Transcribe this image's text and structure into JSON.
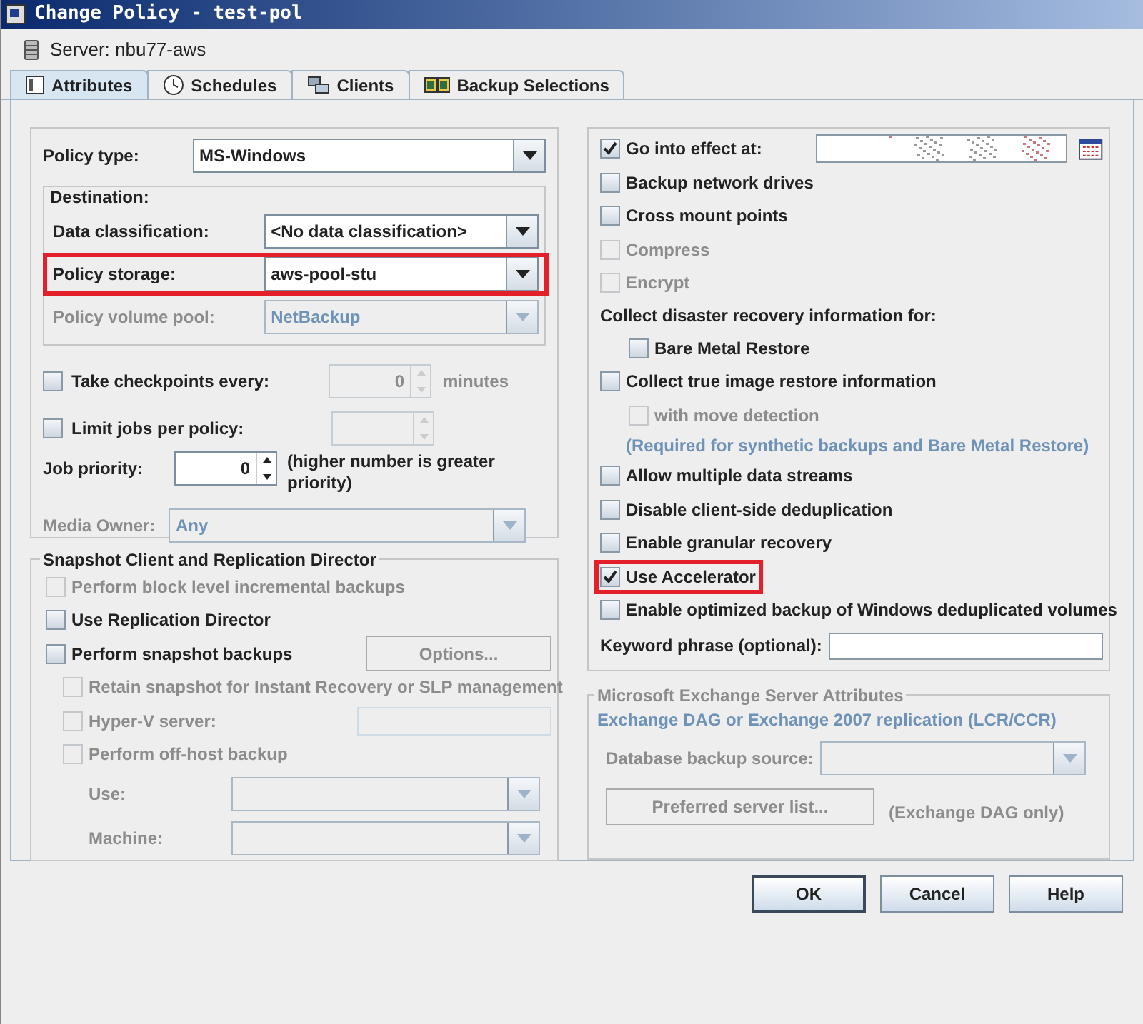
{
  "window": {
    "title": "Change Policy - test-pol"
  },
  "server": "Server: nbu77-aws",
  "tabs": [
    {
      "label": "Attributes",
      "selected": true
    },
    {
      "label": "Schedules",
      "selected": false
    },
    {
      "label": "Clients",
      "selected": false
    },
    {
      "label": "Backup Selections",
      "selected": false
    }
  ],
  "policy_type": {
    "label": "Policy type:",
    "value": "MS-Windows"
  },
  "destination": {
    "title": "Destination:",
    "fields": [
      {
        "label": "Data classification:",
        "value": "<No data classification>",
        "disabled": false,
        "highlighted": false
      },
      {
        "label": "Policy storage:",
        "value": "aws-pool-stu",
        "disabled": false,
        "highlighted": true
      },
      {
        "label": "Policy volume pool:",
        "value": "NetBackup",
        "disabled": true,
        "highlighted": false
      }
    ]
  },
  "checkpoints": {
    "label": "Take checkpoints every:",
    "checked": false,
    "value": "0",
    "unit": "minutes"
  },
  "limit_jobs": {
    "label": "Limit jobs per policy:",
    "checked": false
  },
  "job_priority": {
    "label": "Job priority:",
    "value": "0",
    "note": "(higher number is greater priority)"
  },
  "media_owner": {
    "label": "Media Owner:",
    "value": "Any",
    "disabled": true
  },
  "snapshot": {
    "title": "Snapshot Client and Replication Director",
    "items": [
      {
        "kind": "checkbox",
        "label": "Perform block level incremental backups",
        "checked": false,
        "disabled": true
      },
      {
        "kind": "checkbox",
        "label": "Use Replication Director",
        "checked": false,
        "disabled": false
      },
      {
        "kind": "checkbox",
        "label": "Perform snapshot backups",
        "checked": false,
        "disabled": false,
        "button": {
          "label": "Options...",
          "disabled": true
        },
        "children": [
          {
            "kind": "checkbox",
            "label": "Retain snapshot for Instant Recovery or SLP management",
            "checked": false,
            "disabled": true
          },
          {
            "kind": "checkbox_field",
            "label": "Hyper-V server:",
            "checked": false,
            "disabled": true
          },
          {
            "kind": "checkbox",
            "label": "Perform off-host backup",
            "checked": false,
            "disabled": true,
            "children": [
              {
                "kind": "dropdown",
                "label": "Use:",
                "disabled": true
              },
              {
                "kind": "dropdown",
                "label": "Machine:",
                "disabled": true
              }
            ]
          }
        ]
      }
    ]
  },
  "schedule": {
    "label": "Go into effect at:",
    "checked": true
  },
  "options": [
    {
      "kind": "checkbox",
      "label": "Backup network drives",
      "checked": false,
      "disabled": false,
      "highlighted": false
    },
    {
      "kind": "checkbox",
      "label": "Cross mount points",
      "checked": false,
      "disabled": false,
      "highlighted": false
    },
    {
      "kind": "checkbox",
      "label": "Compress",
      "checked": false,
      "disabled": true,
      "highlighted": false
    },
    {
      "kind": "checkbox",
      "label": "Encrypt",
      "checked": false,
      "disabled": true,
      "highlighted": false
    },
    {
      "kind": "heading",
      "label": "Collect disaster recovery information for:",
      "children": [
        {
          "kind": "checkbox",
          "label": "Bare Metal Restore",
          "checked": false,
          "disabled": false,
          "highlighted": false
        }
      ]
    },
    {
      "kind": "checkbox",
      "label": "Collect true image restore information",
      "checked": false,
      "disabled": false,
      "highlighted": false,
      "children": [
        {
          "kind": "checkbox",
          "label": "with move detection",
          "checked": false,
          "disabled": true,
          "highlighted": false
        },
        {
          "kind": "note",
          "label": "(Required for synthetic backups and Bare Metal Restore)"
        }
      ]
    },
    {
      "kind": "checkbox",
      "label": "Allow multiple data streams",
      "checked": false,
      "disabled": false,
      "highlighted": false
    },
    {
      "kind": "checkbox",
      "label": "Disable client-side deduplication",
      "checked": false,
      "disabled": false,
      "highlighted": false
    },
    {
      "kind": "checkbox",
      "label": "Enable granular recovery",
      "checked": false,
      "disabled": false,
      "highlighted": false
    },
    {
      "kind": "checkbox",
      "label": "Use Accelerator",
      "checked": true,
      "disabled": false,
      "highlighted": true
    },
    {
      "kind": "checkbox",
      "label": "Enable optimized backup of Windows deduplicated volumes",
      "checked": false,
      "disabled": false,
      "highlighted": false
    },
    {
      "kind": "field",
      "label": "Keyword phrase (optional):"
    }
  ],
  "exchange": {
    "title": "Microsoft Exchange Server Attributes",
    "disabled": true,
    "subtitle": "Exchange DAG or Exchange 2007 replication (LCR/CCR)",
    "source_label": "Database backup source:",
    "button": "Preferred server list...",
    "note": "(Exchange DAG only)"
  },
  "buttons": [
    {
      "label": "OK",
      "default": true
    },
    {
      "label": "Cancel",
      "default": false
    },
    {
      "label": "Help",
      "default": false
    }
  ]
}
